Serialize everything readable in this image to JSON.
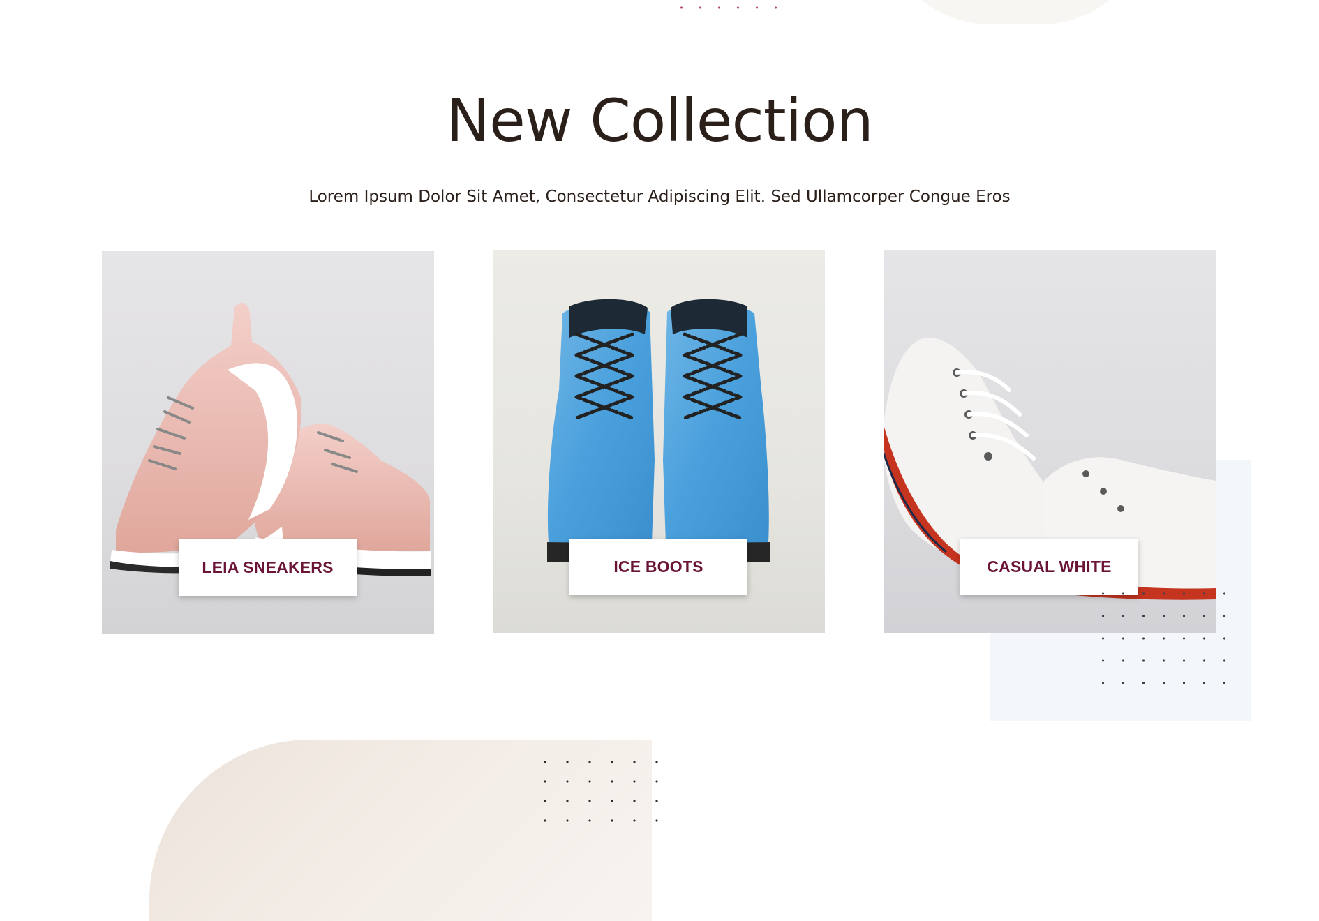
{
  "section": {
    "title": "New Collection",
    "subtitle": "Lorem Ipsum Dolor Sit Amet, Consectetur Adipiscing Elit. Sed Ullamcorper Congue Eros"
  },
  "products": [
    {
      "name": "LEIA SNEAKERS",
      "image": "pink-sneakers-photo"
    },
    {
      "name": "ICE BOOTS",
      "image": "blue-boots-photo"
    },
    {
      "name": "CASUAL WHITE",
      "image": "white-canvas-shoes-photo"
    }
  ],
  "colors": {
    "title_text": "#2b1f1a",
    "label_text": "#6a1537",
    "label_background": "#ffffff",
    "accent_dots": "#b24a61"
  }
}
